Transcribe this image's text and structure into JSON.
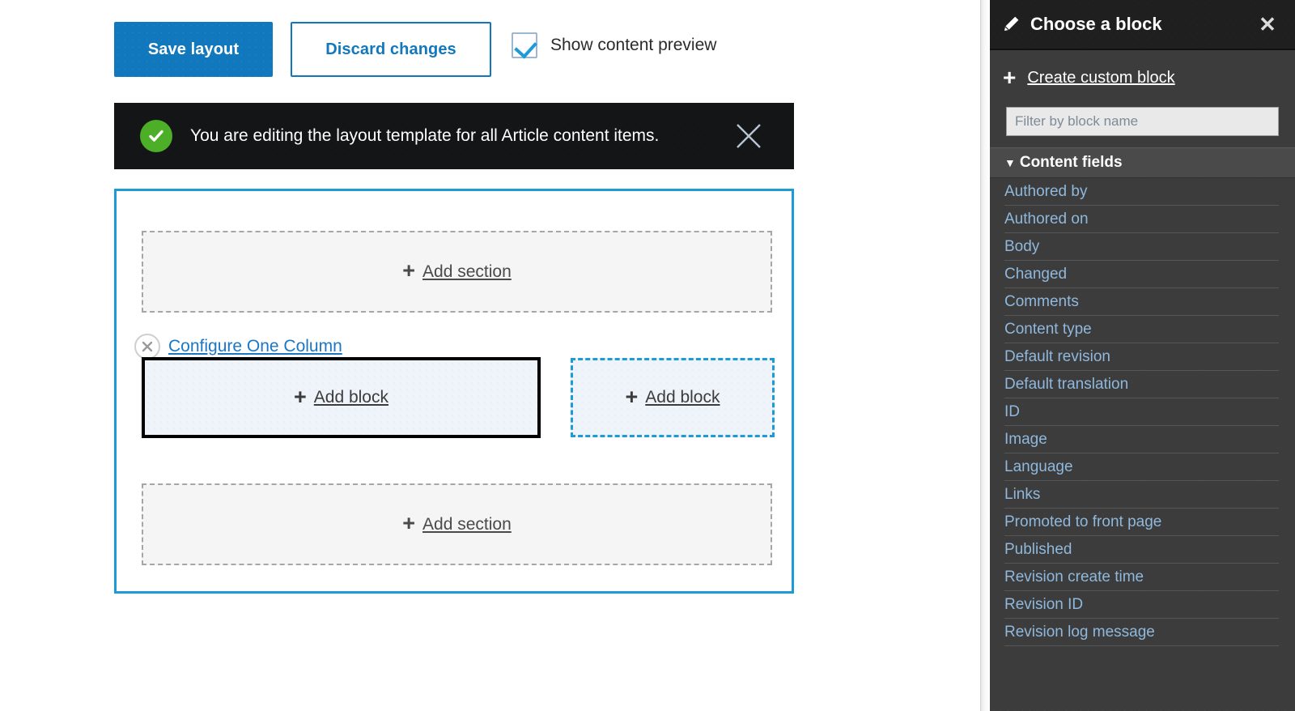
{
  "toolbar": {
    "save_label": "Save layout",
    "discard_label": "Discard changes",
    "preview_checkbox_label": "Show content preview",
    "preview_checked": true
  },
  "status": {
    "icon": "check-circle-icon",
    "message": "You are editing the layout template for all Article content items.",
    "close_icon": "close-icon"
  },
  "layout": {
    "add_section_top_label": "Add section",
    "add_section_bottom_label": "Add section",
    "configure_section_label": "Configure One Column",
    "remove_section_icon": "close-circle-icon",
    "add_block_primary_label": "Add block",
    "add_block_secondary_label": "Add block",
    "plus_icon": "plus-icon"
  },
  "panel": {
    "pencil_icon": "pencil-icon",
    "title": "Choose a block",
    "close_icon": "close-icon",
    "create_custom_block_label": "Create custom block",
    "create_plus_icon": "plus-icon",
    "filter_placeholder": "Filter by block name",
    "filter_value": "",
    "group_caret_icon": "caret-down-icon",
    "group_label": "Content fields",
    "items": [
      {
        "label": "Authored by"
      },
      {
        "label": "Authored on"
      },
      {
        "label": "Body"
      },
      {
        "label": "Changed"
      },
      {
        "label": "Comments"
      },
      {
        "label": "Content type"
      },
      {
        "label": "Default revision"
      },
      {
        "label": "Default translation"
      },
      {
        "label": "ID"
      },
      {
        "label": "Image"
      },
      {
        "label": "Language"
      },
      {
        "label": "Links"
      },
      {
        "label": "Promoted to front page"
      },
      {
        "label": "Published"
      },
      {
        "label": "Revision create time"
      },
      {
        "label": "Revision ID"
      },
      {
        "label": "Revision log message"
      }
    ]
  },
  "colors": {
    "primary_blue": "#1278be",
    "accent_blue": "#1e9ad6",
    "link_blue": "#1b77c4",
    "panel_link_blue": "#8fb8dc",
    "status_bg": "#131516",
    "success_green": "#4caf27",
    "panel_bg": "#3c3c3c",
    "panel_header_bg": "#1f1f1f"
  }
}
